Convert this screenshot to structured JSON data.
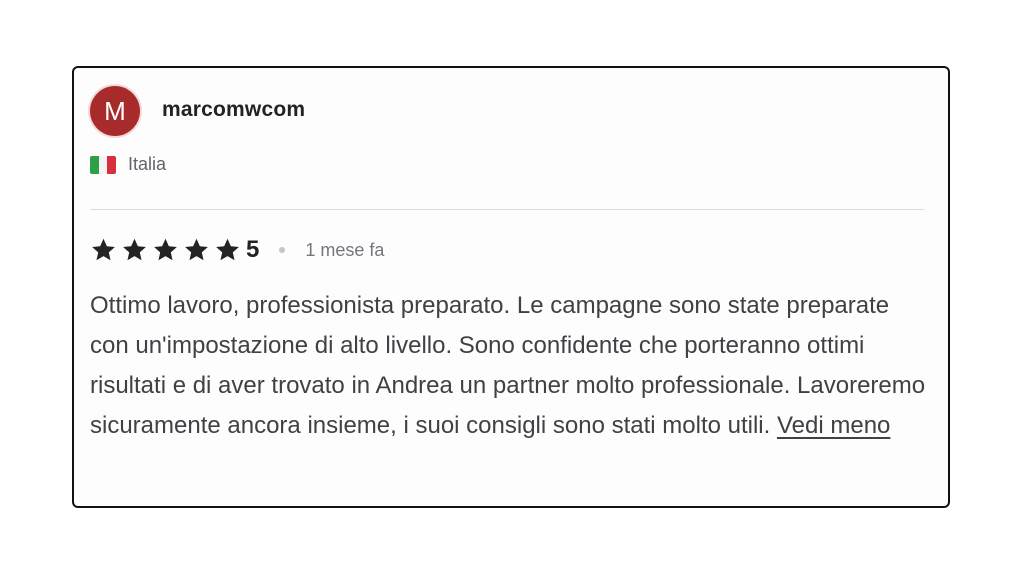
{
  "review": {
    "avatar_initial": "M",
    "username": "marcomwcom",
    "country": "Italia",
    "rating": "5",
    "stars_filled": 5,
    "time_ago": "1 mese fa",
    "text": "Ottimo lavoro, professionista preparato. Le campagne sono state preparate con un'impostazione di alto livello. Sono confidente che porteranno ottimi risultati e di aver trovato in Andrea un partner molto professionale. Lavoreremo sicuramente ancora insieme, i suoi consigli sono stati molto utili.",
    "toggle_label": "Vedi meno"
  },
  "colors": {
    "avatar_bg": "#a72b2b",
    "star": "#222325",
    "text": "#404145",
    "muted": "#74767e"
  },
  "icons": {
    "star": "star-icon",
    "flag": "italy-flag-icon"
  }
}
